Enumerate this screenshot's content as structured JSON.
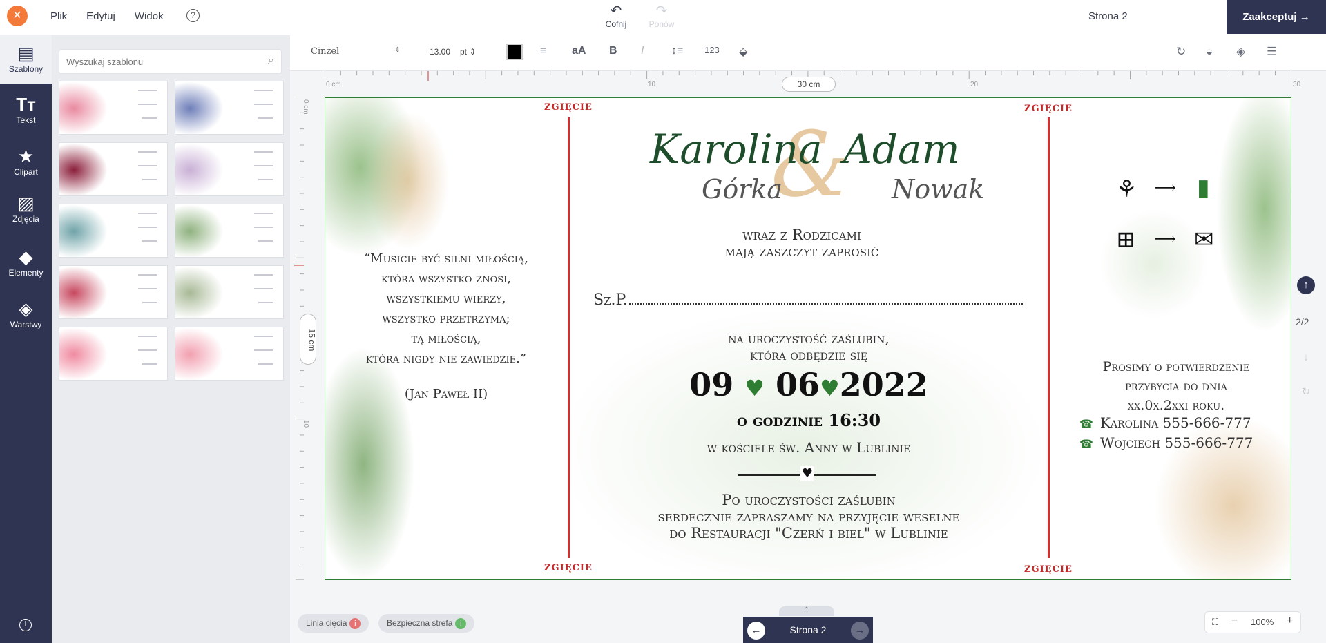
{
  "topbar": {
    "menu": [
      "Plik",
      "Edytuj",
      "Widok"
    ],
    "help": "?",
    "undo_label": "Cofnij",
    "redo_label": "Ponów",
    "page_label": "Strona 2",
    "accept_label": "Zaakceptuj"
  },
  "leftnav": {
    "items": [
      {
        "label": "Szablony",
        "icon": "templates-icon"
      },
      {
        "label": "Tekst",
        "icon": "text-icon"
      },
      {
        "label": "Clipart",
        "icon": "star-icon"
      },
      {
        "label": "Zdjęcia",
        "icon": "image-icon"
      },
      {
        "label": "Elementy",
        "icon": "shapes-icon"
      },
      {
        "label": "Warstwy",
        "icon": "layers-icon"
      }
    ]
  },
  "panel": {
    "search_placeholder": "Wyszukaj szablonu",
    "thumbnail_colors": [
      "#e98aa0",
      "#6f7fb9",
      "#8b1e3a",
      "#c9b0d6",
      "#6fa3a8",
      "#8fb27f",
      "#c7485f",
      "#a8b996",
      "#f08aa0",
      "#f2a0b0"
    ]
  },
  "toolbar": {
    "font": "Cinzel",
    "size": "13.00",
    "unit": "pt",
    "text_color": "#000000"
  },
  "rulers": {
    "h_ticks": [
      "0 cm",
      "10",
      "20",
      "30"
    ],
    "width_badge": "30 cm",
    "v_ticks": [
      "0 cm",
      "10"
    ],
    "height_badge": "15 cm"
  },
  "card": {
    "fold_label": "ZGIĘCIE",
    "name_bride": "Karolina",
    "surname_bride": "Górka",
    "amp": "&",
    "name_groom": "Adam",
    "surname_groom": "Nowak",
    "with_parents_1": "wraz z Rodzicami",
    "with_parents_2": "mają zaszczyt zaprosić",
    "szp_label": "Sz.P.",
    "ceremony_1": "na uroczystość zaślubin,",
    "ceremony_2": "która odbędzie się",
    "date_day": "09",
    "date_month": "06",
    "date_year": "2022",
    "time": "o godzinie 16:30",
    "church": "w kościele św. Anny w Lublinie",
    "reception_1": "Po uroczystości zaślubin",
    "reception_2": "serdecznie zapraszamy na przyjęcie weselne",
    "reception_3": "do Restauracji \"Czerń i biel\" w Lublinie",
    "quote": [
      "“Musicie być silni miłością,",
      "która wszystko znosi,",
      "wszystkiemu wierzy,",
      "wszystko przetrzyma;",
      "tą miłością,",
      "która nigdy nie zawiedzie.”"
    ],
    "quote_author": "(Jan Paweł II)",
    "rsvp": [
      "Prosimy o potwierdzenie",
      "przybycia do dnia",
      "xx.0x.2xxi roku."
    ],
    "phone_1": "Karolina 555-666-777",
    "phone_2": "Wojciech 555-666-777"
  },
  "side": {
    "page_count": "2/2"
  },
  "bottom": {
    "cut_line": "Linia cięcia",
    "safe_zone": "Bezpieczna strefa",
    "page": "Strona 2",
    "zoom": "100%"
  }
}
